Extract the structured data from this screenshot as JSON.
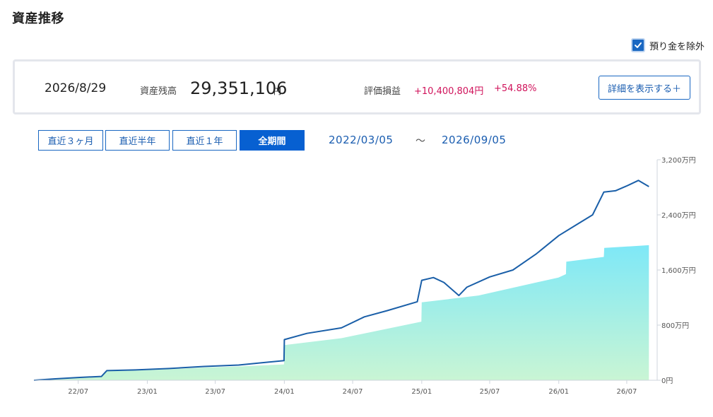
{
  "page": {
    "title": "資産推移"
  },
  "deposit_toggle": {
    "label": "預り金を除外",
    "checked": true
  },
  "summary": {
    "date": "2026/8/29",
    "assets_label": "資産残高",
    "balance": "29,351,106",
    "balance_unit": "円",
    "pl_label": "評価損益",
    "pl_amount": "+10,400,804円",
    "pl_percent": "+54.88%",
    "detail_button": "詳細を表示する＋"
  },
  "range": {
    "buttons": [
      "直近３ヶ月",
      "直近半年",
      "直近１年",
      "全期間"
    ],
    "active_index": 3,
    "start_date": "2022/03/05",
    "separator": "〜",
    "end_date": "2026/09/05"
  },
  "colors": {
    "accent": "#0760d1",
    "line": "#1a5fa8",
    "area_top": "#7ee8f7",
    "area_bottom": "#c9f5d4",
    "positive": "#d0135b"
  },
  "chart_data": {
    "type": "area",
    "title": "",
    "xlabel": "",
    "ylabel": "",
    "y_unit": "万円",
    "ylim": [
      0,
      3200
    ],
    "y_ticks": [
      {
        "value": 0,
        "label": "0円"
      },
      {
        "value": 800,
        "label": "800万円"
      },
      {
        "value": 1600,
        "label": "1,600万円"
      },
      {
        "value": 2400,
        "label": "2,400万円"
      },
      {
        "value": 3200,
        "label": "3,200万円"
      }
    ],
    "x_ticks": [
      {
        "date": "2022-07-01",
        "label": "22/07"
      },
      {
        "date": "2023-01-01",
        "label": "23/01"
      },
      {
        "date": "2023-07-01",
        "label": "23/07"
      },
      {
        "date": "2024-01-01",
        "label": "24/01"
      },
      {
        "date": "2024-07-01",
        "label": "24/07"
      },
      {
        "date": "2025-01-01",
        "label": "25/01"
      },
      {
        "date": "2025-07-01",
        "label": "25/07"
      },
      {
        "date": "2026-01-01",
        "label": "26/01"
      },
      {
        "date": "2026-07-01",
        "label": "26/07"
      }
    ],
    "xlim": [
      "2022-03-05",
      "2026-09-05"
    ],
    "grid": false,
    "series": [
      {
        "kind": "area",
        "points": [
          [
            "2022-03-05",
            0
          ],
          [
            "2022-05-01",
            20
          ],
          [
            "2022-07-01",
            35
          ],
          [
            "2022-09-01",
            45
          ],
          [
            "2022-09-15",
            130
          ],
          [
            "2022-12-01",
            140
          ],
          [
            "2023-03-01",
            160
          ],
          [
            "2023-06-01",
            185
          ],
          [
            "2023-09-01",
            200
          ],
          [
            "2023-12-31",
            230
          ],
          [
            "2024-01-01",
            510
          ],
          [
            "2024-06-01",
            610
          ],
          [
            "2024-12-31",
            850
          ],
          [
            "2025-01-01",
            1130
          ],
          [
            "2025-06-01",
            1230
          ],
          [
            "2025-12-31",
            1490
          ],
          [
            "2026-01-20",
            1540
          ],
          [
            "2026-01-21",
            1720
          ],
          [
            "2026-05-01",
            1790
          ],
          [
            "2026-05-02",
            1920
          ],
          [
            "2026-08-29",
            1960
          ]
        ]
      },
      {
        "kind": "line",
        "points": [
          [
            "2022-03-05",
            0
          ],
          [
            "2022-05-01",
            20
          ],
          [
            "2022-07-01",
            40
          ],
          [
            "2022-09-01",
            55
          ],
          [
            "2022-09-15",
            140
          ],
          [
            "2022-12-01",
            150
          ],
          [
            "2023-03-01",
            170
          ],
          [
            "2023-06-01",
            200
          ],
          [
            "2023-09-01",
            220
          ],
          [
            "2023-12-31",
            285
          ],
          [
            "2024-01-01",
            590
          ],
          [
            "2024-03-01",
            680
          ],
          [
            "2024-06-01",
            760
          ],
          [
            "2024-08-01",
            920
          ],
          [
            "2024-10-01",
            1010
          ],
          [
            "2024-12-20",
            1140
          ],
          [
            "2025-01-01",
            1450
          ],
          [
            "2025-02-01",
            1490
          ],
          [
            "2025-03-01",
            1420
          ],
          [
            "2025-04-10",
            1230
          ],
          [
            "2025-05-01",
            1350
          ],
          [
            "2025-07-01",
            1500
          ],
          [
            "2025-09-01",
            1600
          ],
          [
            "2025-11-01",
            1830
          ],
          [
            "2026-01-01",
            2100
          ],
          [
            "2026-02-15",
            2250
          ],
          [
            "2026-04-01",
            2400
          ],
          [
            "2026-05-01",
            2730
          ],
          [
            "2026-06-01",
            2750
          ],
          [
            "2026-07-01",
            2820
          ],
          [
            "2026-08-01",
            2900
          ],
          [
            "2026-08-29",
            2810
          ]
        ]
      }
    ]
  }
}
